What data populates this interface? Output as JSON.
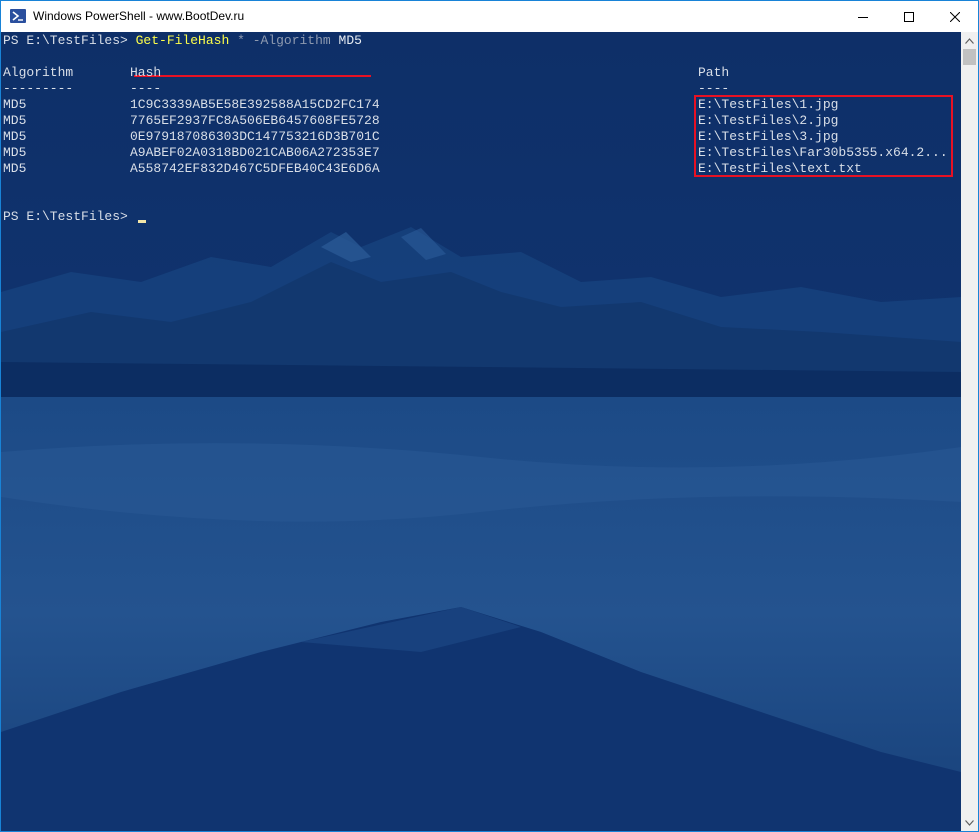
{
  "window": {
    "title": "Windows PowerShell - www.BootDev.ru",
    "icon": "powershell-icon",
    "controls": [
      "minimize-icon",
      "maximize-icon",
      "close-icon"
    ]
  },
  "console": {
    "prompt": "PS E:\\TestFiles> ",
    "command": {
      "name": "Get-FileHash",
      "arg": "*",
      "param": "-Algorithm",
      "value": "MD5"
    },
    "headers": {
      "algorithm": "Algorithm",
      "hash": "Hash",
      "path": "Path"
    },
    "separators": {
      "algorithm": "---------",
      "hash": "----",
      "path": "----"
    },
    "rows": [
      {
        "algorithm": "MD5",
        "hash": "1C9C3339AB5E58E392588A15CD2FC174",
        "path": "E:\\TestFiles\\1.jpg"
      },
      {
        "algorithm": "MD5",
        "hash": "7765EF2937FC8A506EB6457608FE5728",
        "path": "E:\\TestFiles\\2.jpg"
      },
      {
        "algorithm": "MD5",
        "hash": "0E979187086303DC147753216D3B701C",
        "path": "E:\\TestFiles\\3.jpg"
      },
      {
        "algorithm": "MD5",
        "hash": "A9ABEF02A0318BD021CAB06A272353E7",
        "path": "E:\\TestFiles\\Far30b5355.x64.2..."
      },
      {
        "algorithm": "MD5",
        "hash": "A558742EF832D467C5DFEB40C43E6D6A",
        "path": "E:\\TestFiles\\text.txt"
      }
    ],
    "final_prompt": "PS E:\\TestFiles> "
  },
  "colors": {
    "console_bg": "#0f336e",
    "text": "#d9dfe8",
    "cmdlet": "#ffff4a",
    "param": "#8e9ab0",
    "highlight": "#e81123"
  }
}
